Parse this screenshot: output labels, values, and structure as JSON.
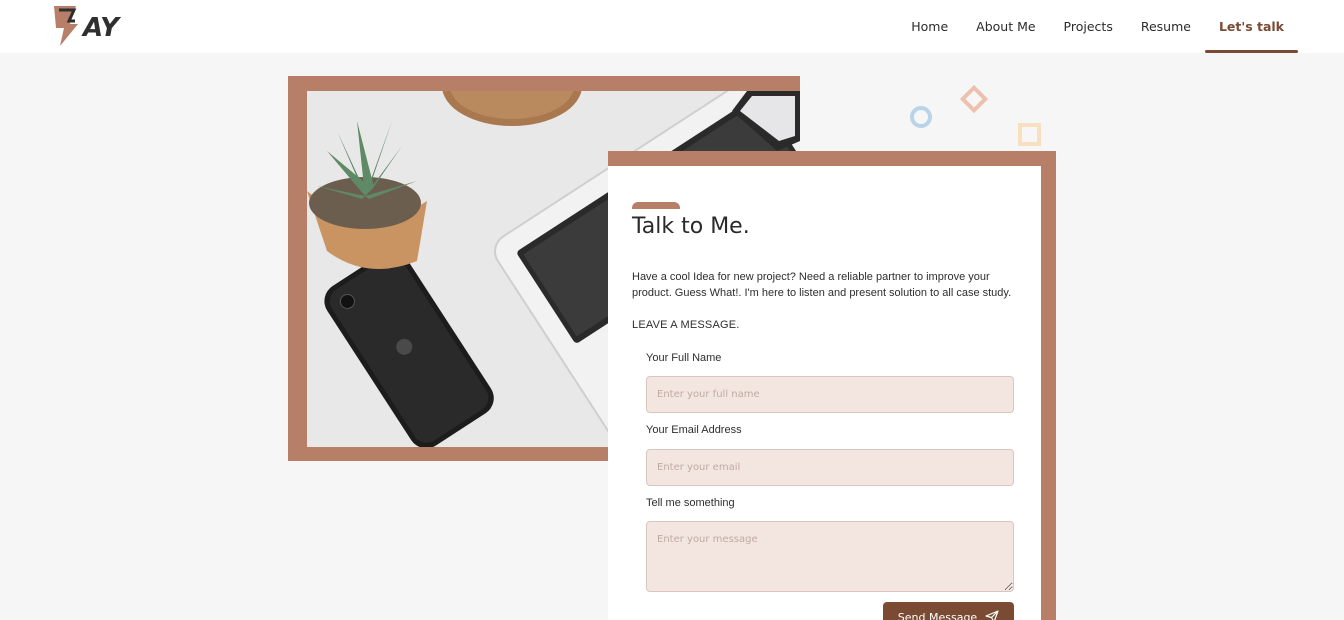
{
  "header": {
    "logo_text": "BAY",
    "nav": [
      {
        "label": "Home"
      },
      {
        "label": "About Me"
      },
      {
        "label": "Projects"
      },
      {
        "label": "Resume"
      },
      {
        "label": "Let's talk",
        "active": true
      }
    ]
  },
  "contact": {
    "title": "Talk to Me.",
    "intro": "Have a cool Idea for new project? Need a reliable partner to improve your product. Guess What!. I'm here to listen and present solution to all case study.",
    "leave_message": "LEAVE A MESSAGE.",
    "fields": {
      "name_label": "Your Full Name",
      "name_placeholder": "Enter your full name",
      "email_label": "Your Email Address",
      "email_placeholder": "Enter your email",
      "message_label": "Tell me something",
      "message_placeholder": "Enter your message"
    },
    "send_label": "Send Message",
    "send_icon": "paper-plane-icon"
  },
  "colors": {
    "accent": "#b87f68",
    "accent_dark": "#7a4a33",
    "input_bg": "#f3e6e1"
  }
}
